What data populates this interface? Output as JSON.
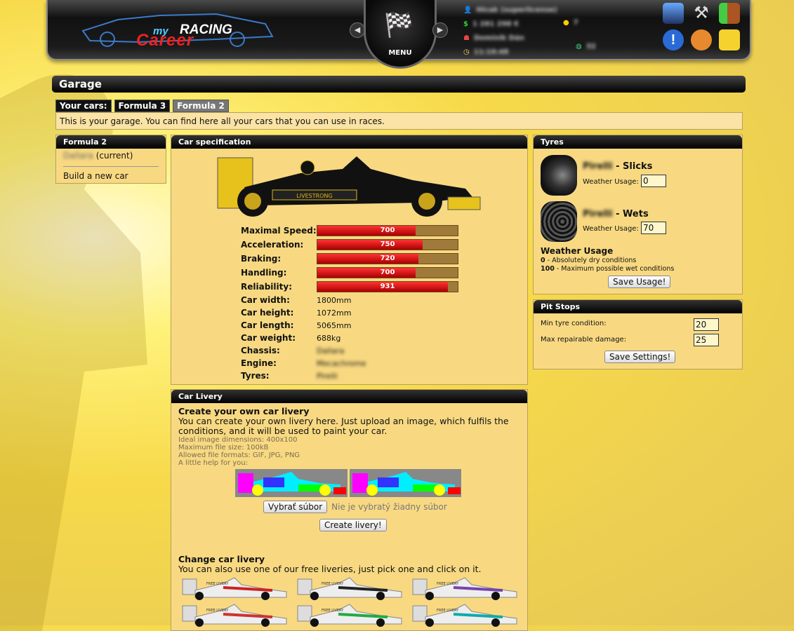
{
  "logo": {
    "line1": "my",
    "line2": "RACING",
    "line3": "Career"
  },
  "menu": {
    "label": "MENU"
  },
  "stats": {
    "user": "Hicak (superlicense)",
    "money": "1 281 298 €",
    "coins": "7",
    "team": "Dominik Dán",
    "time": "11:16:48",
    "online": "32"
  },
  "page": {
    "title": "Garage"
  },
  "tabs": {
    "label": "Your cars:",
    "items": [
      "Formula 3",
      "Formula 2"
    ]
  },
  "info": {
    "text": "This is your garage. You can find here all your cars that you can use in races."
  },
  "sidebar": {
    "title": "Formula 2",
    "car": "Dallara",
    "car_suffix": "(current)",
    "build_link": "Build a new car"
  },
  "spec": {
    "title": "Car specification",
    "car_text": "LIVESTRONG",
    "bars": [
      {
        "label": "Maximal Speed:",
        "value": 700
      },
      {
        "label": "Acceleration:",
        "value": 750
      },
      {
        "label": "Braking:",
        "value": 720
      },
      {
        "label": "Handling:",
        "value": 700
      },
      {
        "label": "Reliability:",
        "value": 931
      }
    ],
    "bar_max": 1000,
    "details": [
      {
        "label": "Car width:",
        "value": "1800mm"
      },
      {
        "label": "Car height:",
        "value": "1072mm"
      },
      {
        "label": "Car length:",
        "value": "5065mm"
      },
      {
        "label": "Car weight:",
        "value": "688kg"
      },
      {
        "label": "Chassis:",
        "value": "Dallara"
      },
      {
        "label": "Engine:",
        "value": "Mecachrome"
      },
      {
        "label": "Tyres:",
        "value": "Pirelli"
      }
    ]
  },
  "tyres": {
    "title": "Tyres",
    "items": [
      {
        "brand": "Pirelli",
        "type": " - Slicks",
        "usage_label": "Weather Usage:",
        "usage": "0"
      },
      {
        "brand": "Pirelli",
        "type": " - Wets",
        "usage_label": "Weather Usage:",
        "usage": "70"
      }
    ],
    "help_title": "Weather Usage",
    "help1_num": "0",
    "help1": " - Absolutely dry conditions",
    "help2_num": "100",
    "help2": " - Maximum possible wet conditions",
    "save": "Save Usage!"
  },
  "pit": {
    "title": "Pit Stops",
    "min_label": "Min tyre condition:",
    "min_value": "20",
    "max_label": "Max repairable damage:",
    "max_value": "25",
    "save": "Save Settings!"
  },
  "livery": {
    "title": "Car Livery",
    "create_title": "Create your own car livery",
    "create_text": "You can create your own livery here. Just upload an image, which fulfils the conditions, and it will be used to paint your car.",
    "req": [
      "Ideal image dimensions: 400x100",
      "Maximum file size: 100kB",
      "Allowed file formats: GIF, JPG, PNG",
      "A little help for you:"
    ],
    "file_btn": "Vybrať súbor",
    "file_none": "Nie je vybratý žiadny súbor",
    "create_btn": "Create livery!",
    "change_title": "Change car livery",
    "change_text": "You can also use one of our free liveries, just pick one and click on it.",
    "free_label": "FREE LIVERY"
  },
  "colors": {
    "bar": "#d51a1a",
    "accent": "#f5d76e"
  }
}
